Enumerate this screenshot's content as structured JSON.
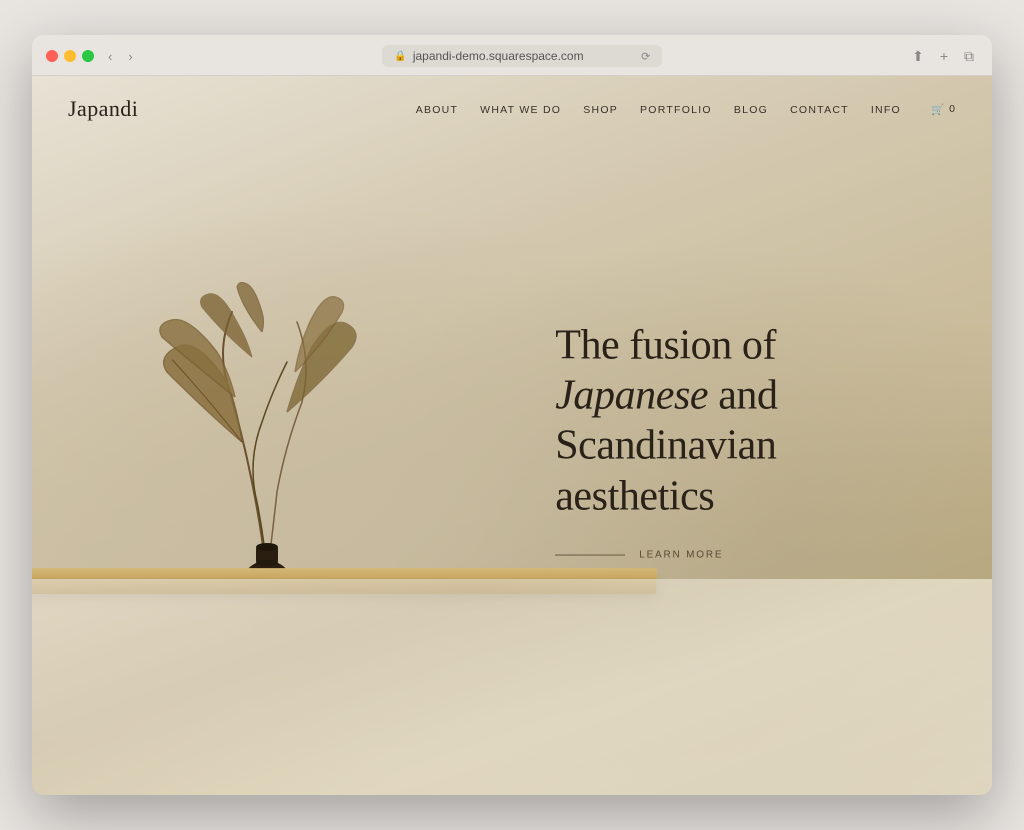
{
  "browser": {
    "url": "japandi-demo.squarespace.com",
    "reload_label": "⟳",
    "back_label": "‹",
    "forward_label": "›",
    "share_label": "⬆",
    "new_tab_label": "+",
    "windows_label": "⧉"
  },
  "site": {
    "logo": "Japandi",
    "nav": {
      "items": [
        {
          "label": "ABOUT",
          "href": "#"
        },
        {
          "label": "WHAT WE DO",
          "href": "#"
        },
        {
          "label": "SHOP",
          "href": "#"
        },
        {
          "label": "PORTFOLIO",
          "href": "#"
        },
        {
          "label": "BLOG",
          "href": "#"
        },
        {
          "label": "CONTACT",
          "href": "#"
        },
        {
          "label": "INFO",
          "href": "#"
        }
      ],
      "cart_count": "0"
    },
    "hero": {
      "heading_part1": "The fusion of ",
      "heading_italic": "Japanese",
      "heading_part2": " and Scandinavian aesthetics",
      "learn_more": "LEARN MORE"
    }
  }
}
